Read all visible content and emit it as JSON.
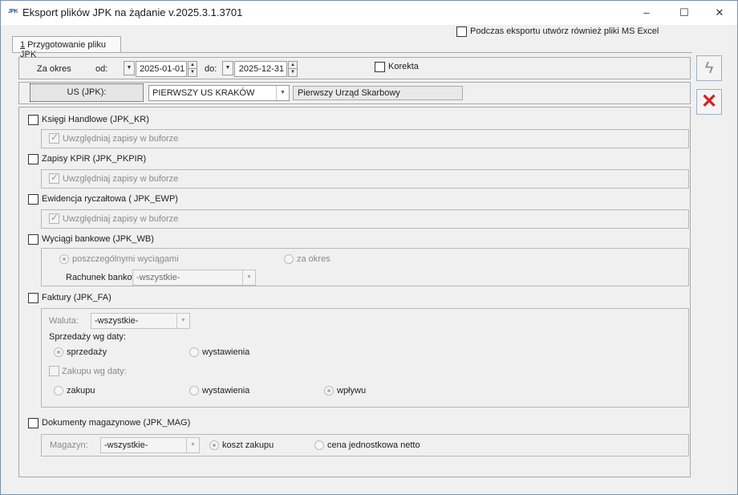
{
  "window": {
    "title": "Eksport plików JPK na żądanie v.2025.3.1.3701",
    "icon_text": "JPK",
    "minimize": "–",
    "maximize": "☐",
    "close": "✕"
  },
  "excel_option": {
    "label": "Podczas eksportu utwórz również pliki MS Excel",
    "checked": false
  },
  "tab": {
    "hotkey": "1",
    "label": " Przygotowanie pliku JPK"
  },
  "period": {
    "label": "Za okres",
    "from_label": "od:",
    "from": "2025-01-01",
    "to_label": "do:",
    "to": "2025-12-31",
    "correction_label": "Korekta"
  },
  "us": {
    "button_label": "US (JPK):",
    "code": "PIERWSZY US KRAKÓW",
    "name": "Pierwszy Urząd Skarbowy"
  },
  "sections": {
    "kr": {
      "label": "Księgi Handlowe (JPK_KR)",
      "buffer": "Uwzględniaj zapisy w buforze"
    },
    "pkpir": {
      "label": "Zapisy KPiR (JPK_PKPIR)",
      "buffer": "Uwzględniaj zapisy w buforze"
    },
    "ewp": {
      "label": "Ewidencja ryczałtowa ( JPK_EWP)",
      "buffer": "Uwzględniaj zapisy w buforze"
    },
    "wb": {
      "label": "Wyciągi bankowe (JPK_WB)",
      "opt1": "poszczególnymi wyciągami",
      "opt2": "za okres",
      "account_label": "Rachunek bankowy:",
      "account_value": "-wszystkie-"
    },
    "fa": {
      "label": "Faktury (JPK_FA)",
      "currency_label": "Waluta:",
      "currency_value": "-wszystkie-",
      "sales_date_label": "Sprzedaży wg daty:",
      "sales_opt1": "sprzedaży",
      "sales_opt2": "wystawienia",
      "purchase_label": "Zakupu wg daty:",
      "purch_opt1": "zakupu",
      "purch_opt2": "wystawienia",
      "purch_opt3": "wpływu"
    },
    "mag": {
      "label": "Dokumenty magazynowe (JPK_MAG)",
      "warehouse_label": "Magazyn:",
      "warehouse_value": "-wszystkie-",
      "opt1": "koszt zakupu",
      "opt2": "cena jednostkowa netto"
    }
  },
  "side_buttons": {
    "export_icon": "lightning-icon",
    "cancel_icon": "close-x-icon"
  },
  "icons": {
    "check": "✓",
    "arrow_down": "▼",
    "arrow_up": "▲",
    "bolt": "ϟ",
    "x": "✕"
  },
  "colors": {
    "accent_blue": "#2a5ea8",
    "cancel_red": "#d62020"
  }
}
